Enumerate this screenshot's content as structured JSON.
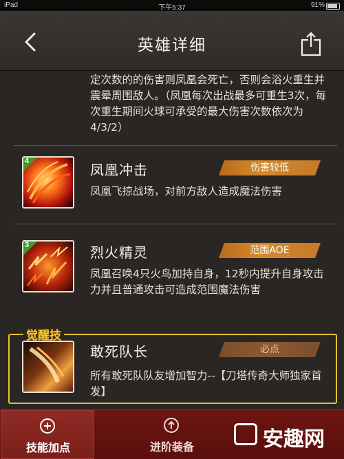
{
  "status": {
    "device": "iPad",
    "wifi": "wifi-icon",
    "time": "下午5:37",
    "battery": "91%"
  },
  "header": {
    "title": "英雄详细",
    "back_icon": "chevron-left-icon",
    "share_icon": "share-icon"
  },
  "intro_text": "定次数的的伤害则凤凰会死亡，否则会浴火重生并震晕周围敌人。（凤凰每次出战最多可重生3次，每次重生期间火球可承受的最大伤害次数依次为4/3/2）",
  "skills": [
    {
      "level": "4",
      "name": "凤凰冲击",
      "tag": "伤害较低",
      "desc": "凤凰飞掠战场，对前方敌人造成魔法伤害"
    },
    {
      "level": "3",
      "name": "烈火精灵",
      "tag": "范围AOE",
      "desc": "凤凰召唤4只火鸟加持自身，12秒内提升自身攻击力并且普通攻击可造成范围魔法伤害"
    },
    {
      "level": "",
      "name": "敢死队长",
      "tag": "必点",
      "desc": "所有敢死队队友增加智力--【刀塔传奇大师独家首发】"
    }
  ],
  "awaken_label": "觉醒技",
  "tabs": [
    {
      "label": "技能加点",
      "icon": "plus-circle-icon",
      "active": true
    },
    {
      "label": "进阶装备",
      "icon": "arrow-up-circle-icon",
      "active": false
    }
  ],
  "watermark": {
    "text": "安趣网"
  },
  "colors": {
    "accent_tag": "#d48a2a",
    "tab_bar": "#6d1512",
    "awaken_border": "#e4c13b"
  }
}
